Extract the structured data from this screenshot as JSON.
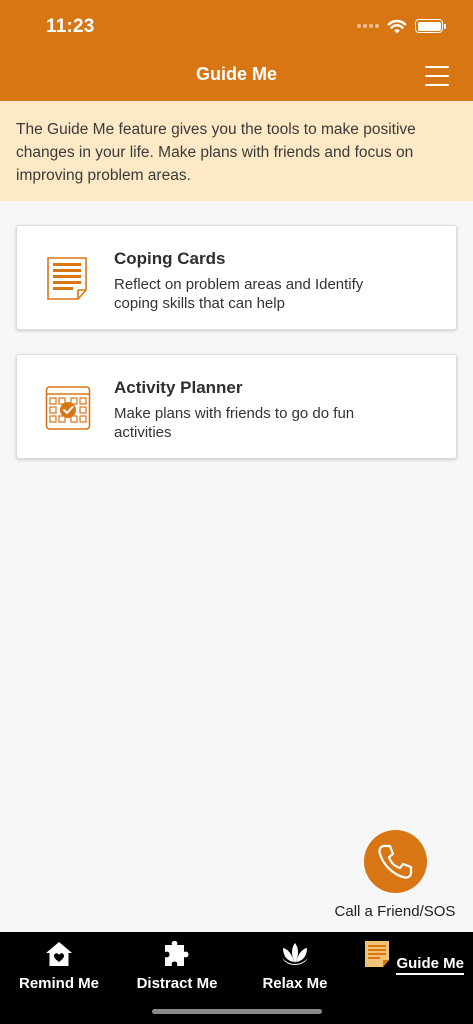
{
  "status_bar": {
    "time": "11:23"
  },
  "header": {
    "title": "Guide Me"
  },
  "intro": {
    "text": "The Guide Me feature gives you the tools to make positive changes in your life. Make plans with friends and focus on improving problem areas."
  },
  "cards": [
    {
      "title": "Coping Cards",
      "description": "Reflect on problem areas and Identify coping skills that can help",
      "icon": "notepad-icon"
    },
    {
      "title": "Activity Planner",
      "description": "Make plans with friends to go do fun activities",
      "icon": "calendar-check-icon"
    }
  ],
  "sos": {
    "label": "Call a Friend/SOS",
    "icon": "phone-icon"
  },
  "tabs": [
    {
      "label": "Remind Me",
      "icon": "home-heart-icon",
      "active": false
    },
    {
      "label": "Distract Me",
      "icon": "puzzle-icon",
      "active": false
    },
    {
      "label": "Relax Me",
      "icon": "lotus-icon",
      "active": false
    },
    {
      "label": "Guide Me",
      "icon": "notepad-icon",
      "active": true
    }
  ],
  "colors": {
    "accent": "#d87614",
    "intro_background": "#fde9c6",
    "tabbar": "#000000",
    "page_background": "#f7f7f7"
  }
}
